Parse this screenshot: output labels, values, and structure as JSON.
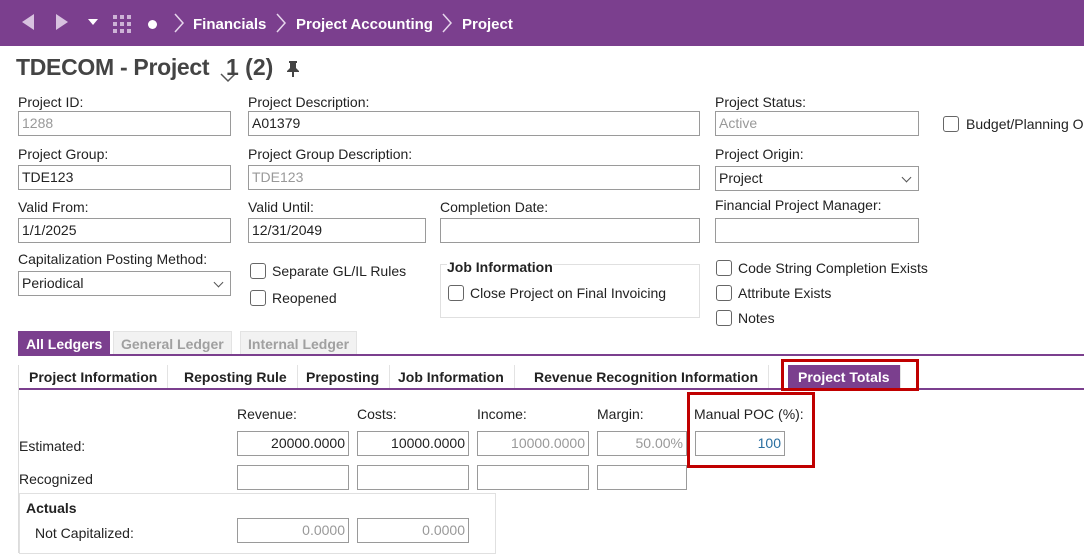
{
  "nav": {
    "breadcrumbs": [
      "Financials",
      "Project Accounting",
      "Project"
    ]
  },
  "header": {
    "title": "TDECOM - Project",
    "record": "1 (2)"
  },
  "form": {
    "project_id_label": "Project ID:",
    "project_id": "1288",
    "project_description_label": "Project Description:",
    "project_description": "A01379",
    "project_status_label": "Project Status:",
    "project_status": "Active",
    "budget_planning_label": "Budget/Planning On",
    "project_group_label": "Project Group:",
    "project_group": "TDE123",
    "project_group_description_label": "Project Group Description:",
    "project_group_description": "TDE123",
    "project_origin_label": "Project Origin:",
    "project_origin": "Project",
    "valid_from_label": "Valid From:",
    "valid_from": "1/1/2025",
    "valid_until_label": "Valid Until:",
    "valid_until": "12/31/2049",
    "completion_date_label": "Completion Date:",
    "completion_date": "",
    "financial_pm_label": "Financial Project Manager:",
    "financial_pm": "",
    "cap_posting_method_label": "Capitalization Posting Method:",
    "cap_posting_method": "Periodical",
    "separate_gl_il_label": "Separate GL/IL Rules",
    "reopened_label": "Reopened",
    "job_information_title": "Job Information",
    "close_project_label": "Close Project on Final Invoicing",
    "code_string_label": "Code String Completion Exists",
    "attribute_exists_label": "Attribute Exists",
    "notes_label": "Notes"
  },
  "ledger_tabs": [
    "All Ledgers",
    "General Ledger",
    "Internal Ledger"
  ],
  "sub_tabs": [
    "Project Information",
    "Reposting Rule",
    "Preposting",
    "Job Information",
    "Revenue Recognition Information",
    "Project Totals"
  ],
  "totals": {
    "col_revenue": "Revenue:",
    "col_costs": "Costs:",
    "col_income": "Income:",
    "col_margin": "Margin:",
    "col_manual_poc": "Manual POC (%):",
    "row_estimated": "Estimated:",
    "row_recognized": "Recognized",
    "est_revenue": "20000.0000",
    "est_costs": "10000.0000",
    "est_income": "10000.0000",
    "est_margin": "50.00%",
    "manual_poc": "100",
    "actuals_title": "Actuals",
    "row_not_capitalized": "Not Capitalized:",
    "nc_revenue": "0.0000",
    "nc_costs": "0.0000"
  }
}
